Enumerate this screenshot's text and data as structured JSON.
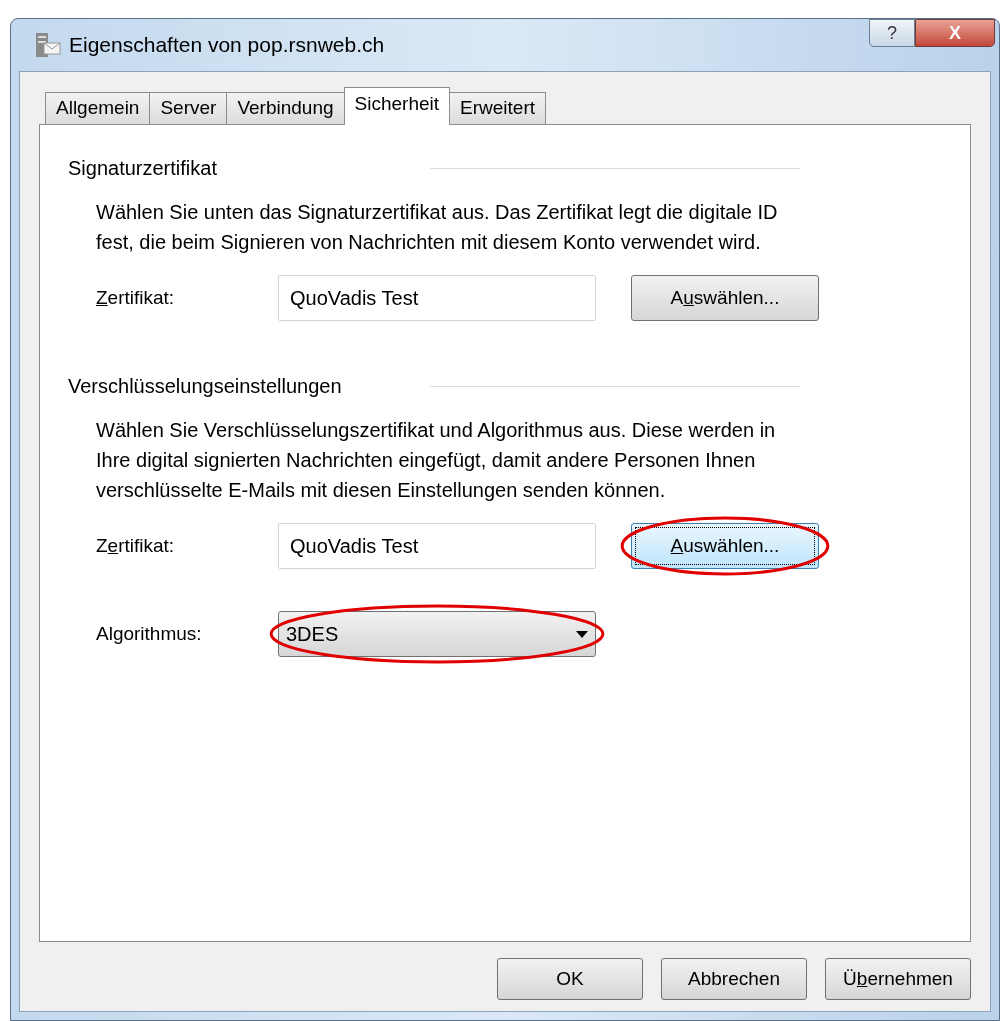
{
  "window": {
    "title": "Eigenschaften von pop.rsnweb.ch"
  },
  "title_buttons": [
    "?",
    "X"
  ],
  "tabs": [
    {
      "label": "Allgemein",
      "selected": false
    },
    {
      "label": "Server",
      "selected": false
    },
    {
      "label": "Verbindung",
      "selected": false
    },
    {
      "label": "Sicherheit",
      "selected": true
    },
    {
      "label": "Erweitert",
      "selected": false
    }
  ],
  "sections": [
    {
      "heading": "Signaturzertifikat",
      "text": "Wählen Sie unten das Signaturzertifikat aus. Das Zertifikat legt die digitale ID fest, die beim Signieren von Nachrichten mit diesem Konto verwendet wird.",
      "rows": [
        {
          "kind": "certificate",
          "label": {
            "key": "Z",
            "after": "ertifikat:"
          },
          "value": "QuoVadis Test",
          "button": {
            "before": "A",
            "key": "u",
            "after": "swählen..."
          },
          "highlighted": false,
          "focused": false
        }
      ]
    },
    {
      "heading": "Verschlüsselungseinstellungen",
      "text": "Wählen Sie Verschlüsselungszertifikat und Algorithmus aus. Diese werden in Ihre digital signierten Nachrichten eingefügt, damit andere Personen Ihnen verschlüsselte E-Mails mit diesen Einstellungen senden können.",
      "rows": [
        {
          "kind": "certificate",
          "label": {
            "before": "Z",
            "key": "e",
            "after": "rtifikat:"
          },
          "value": "QuoVadis Test",
          "button": {
            "key": "A",
            "after": "uswählen..."
          },
          "highlighted": true,
          "focused": true
        },
        {
          "kind": "dropdown",
          "label": {
            "after": "Algorithmus:"
          },
          "value": "3DES",
          "highlighted": true
        }
      ]
    }
  ],
  "buttons": [
    {
      "after": "OK"
    },
    {
      "after": "Abbrechen"
    },
    {
      "before": "Ü",
      "key": "b",
      "after": "ernehmen"
    }
  ]
}
